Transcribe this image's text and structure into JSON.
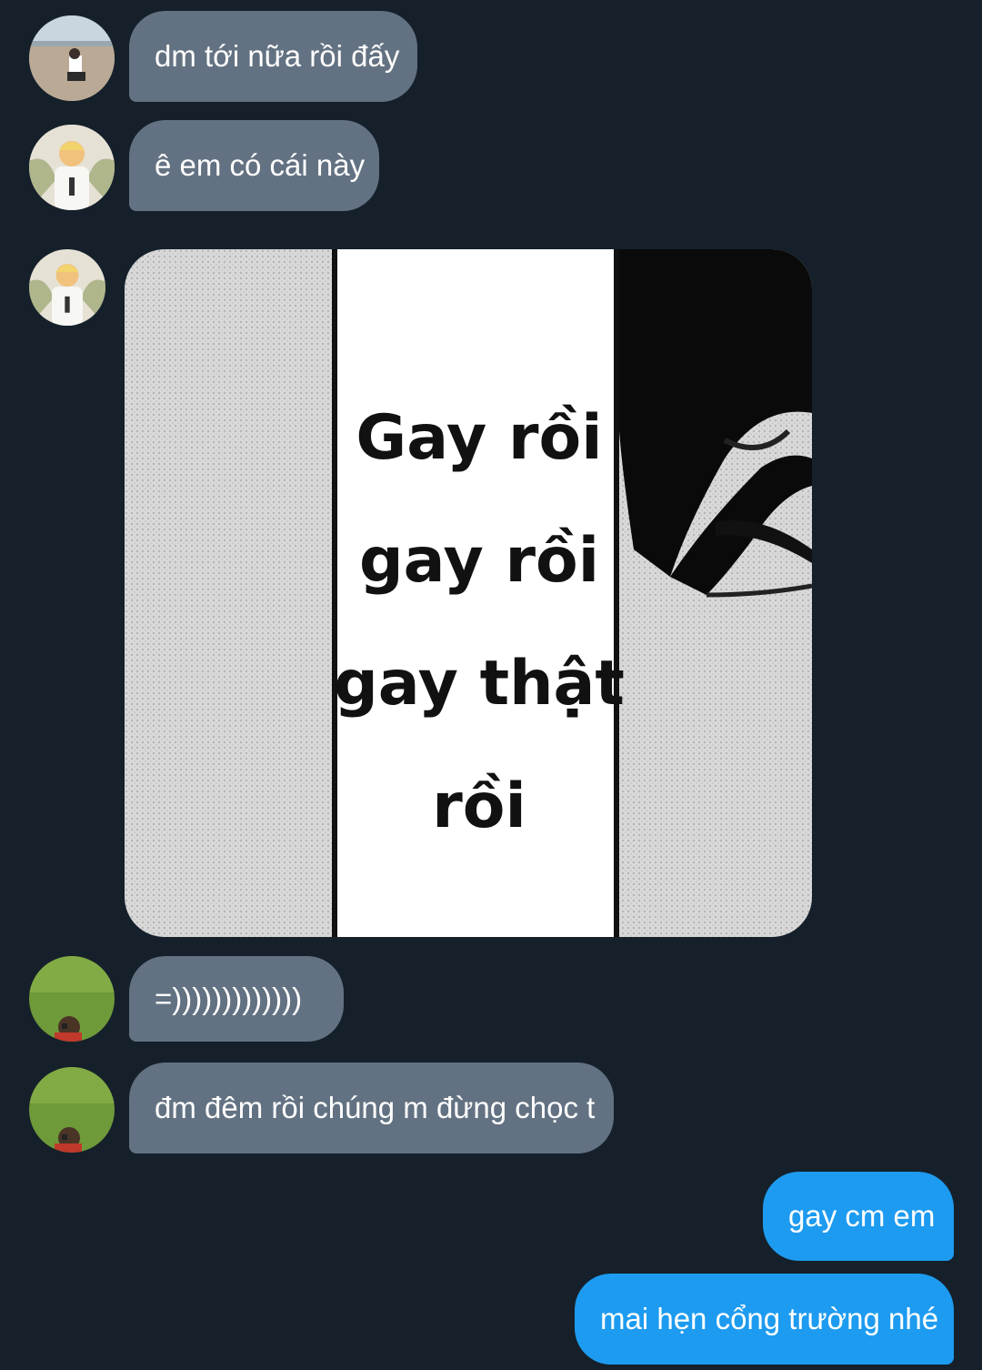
{
  "messages": [
    {
      "type": "text",
      "direction": "incoming",
      "text": "dm tới nữa rồi đấy"
    },
    {
      "type": "text",
      "direction": "incoming",
      "text": "ê em có cái này"
    },
    {
      "type": "image",
      "direction": "incoming",
      "image_caption_lines": [
        "Gay rồi",
        "gay rồi",
        "gay thật",
        "rồi"
      ]
    },
    {
      "type": "text",
      "direction": "incoming",
      "text": "=)))))))))))))"
    },
    {
      "type": "text",
      "direction": "incoming",
      "text": "đm đêm rồi chúng m đừng chọc t"
    },
    {
      "type": "text",
      "direction": "outgoing",
      "text": "gay cm em"
    },
    {
      "type": "text",
      "direction": "outgoing",
      "text": "mai hẹn cổng trường nhé"
    }
  ],
  "colors": {
    "background": "#15202b",
    "incoming_bubble": "#637282",
    "outgoing_bubble": "#1d9bf0",
    "text": "#ffffff"
  }
}
